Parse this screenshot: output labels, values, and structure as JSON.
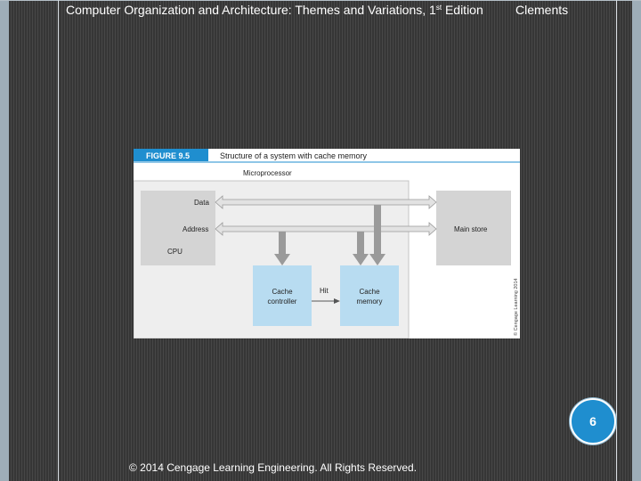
{
  "slide": {
    "title_main": "Computer Organization and Architecture: Themes and Variations, 1",
    "title_sup": "st",
    "title_end": " Edition",
    "author": "Clements",
    "page_number": "6",
    "copyright": "© 2014 Cengage Learning Engineering. All Rights Reserved."
  },
  "figure": {
    "tag": "FIGURE 9.5",
    "caption": "Structure of a system with cache memory",
    "microprocessor_label": "Microprocessor",
    "data_label": "Data",
    "address_label": "Address",
    "cpu_label": "CPU",
    "main_store_label": "Main store",
    "cache_controller_line1": "Cache",
    "cache_controller_line2": "controller",
    "cache_memory_line1": "Cache",
    "cache_memory_line2": "memory",
    "hit_label": "Hit",
    "credit": "© Cengage Learning 2014"
  },
  "colors": {
    "tag_bg": "#1f8ecf",
    "box_gray": "#d4d4d4",
    "cache_blue": "#b8dcf1",
    "arrow_gray": "#9a9a9a"
  }
}
